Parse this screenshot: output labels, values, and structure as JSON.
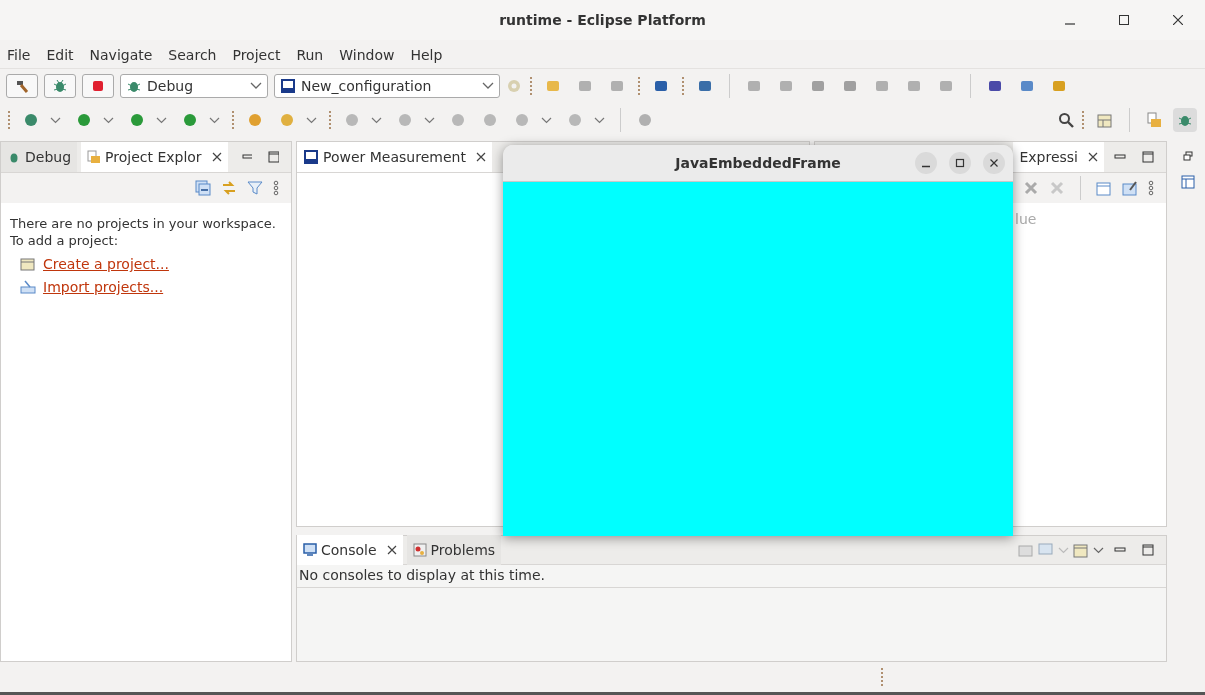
{
  "window": {
    "title": "runtime - Eclipse Platform"
  },
  "menu": [
    "File",
    "Edit",
    "Navigate",
    "Search",
    "Project",
    "Run",
    "Window",
    "Help"
  ],
  "toolbar": {
    "launch_mode": "Debug",
    "launch_configuration": "New_configuration"
  },
  "left_panel": {
    "tabs": [
      {
        "label": "Debug",
        "selected": false
      },
      {
        "label": "Project Explor",
        "selected": true
      }
    ],
    "message": [
      "There are no projects in your workspace.",
      "To add a project:"
    ],
    "links": [
      "Create a project...",
      "Import projects..."
    ]
  },
  "editor": {
    "tabs": [
      {
        "label": "Power Measurement",
        "selected": true
      }
    ]
  },
  "right_panel": {
    "tabs": [
      {
        "label": "Expressi",
        "selected": true
      }
    ],
    "column_header": "lue"
  },
  "console": {
    "tabs": [
      {
        "label": "Console",
        "selected": true
      },
      {
        "label": "Problems",
        "selected": false
      }
    ],
    "message": "No consoles to display at this time."
  },
  "frame": {
    "title": "JavaEmbeddedFrame"
  }
}
